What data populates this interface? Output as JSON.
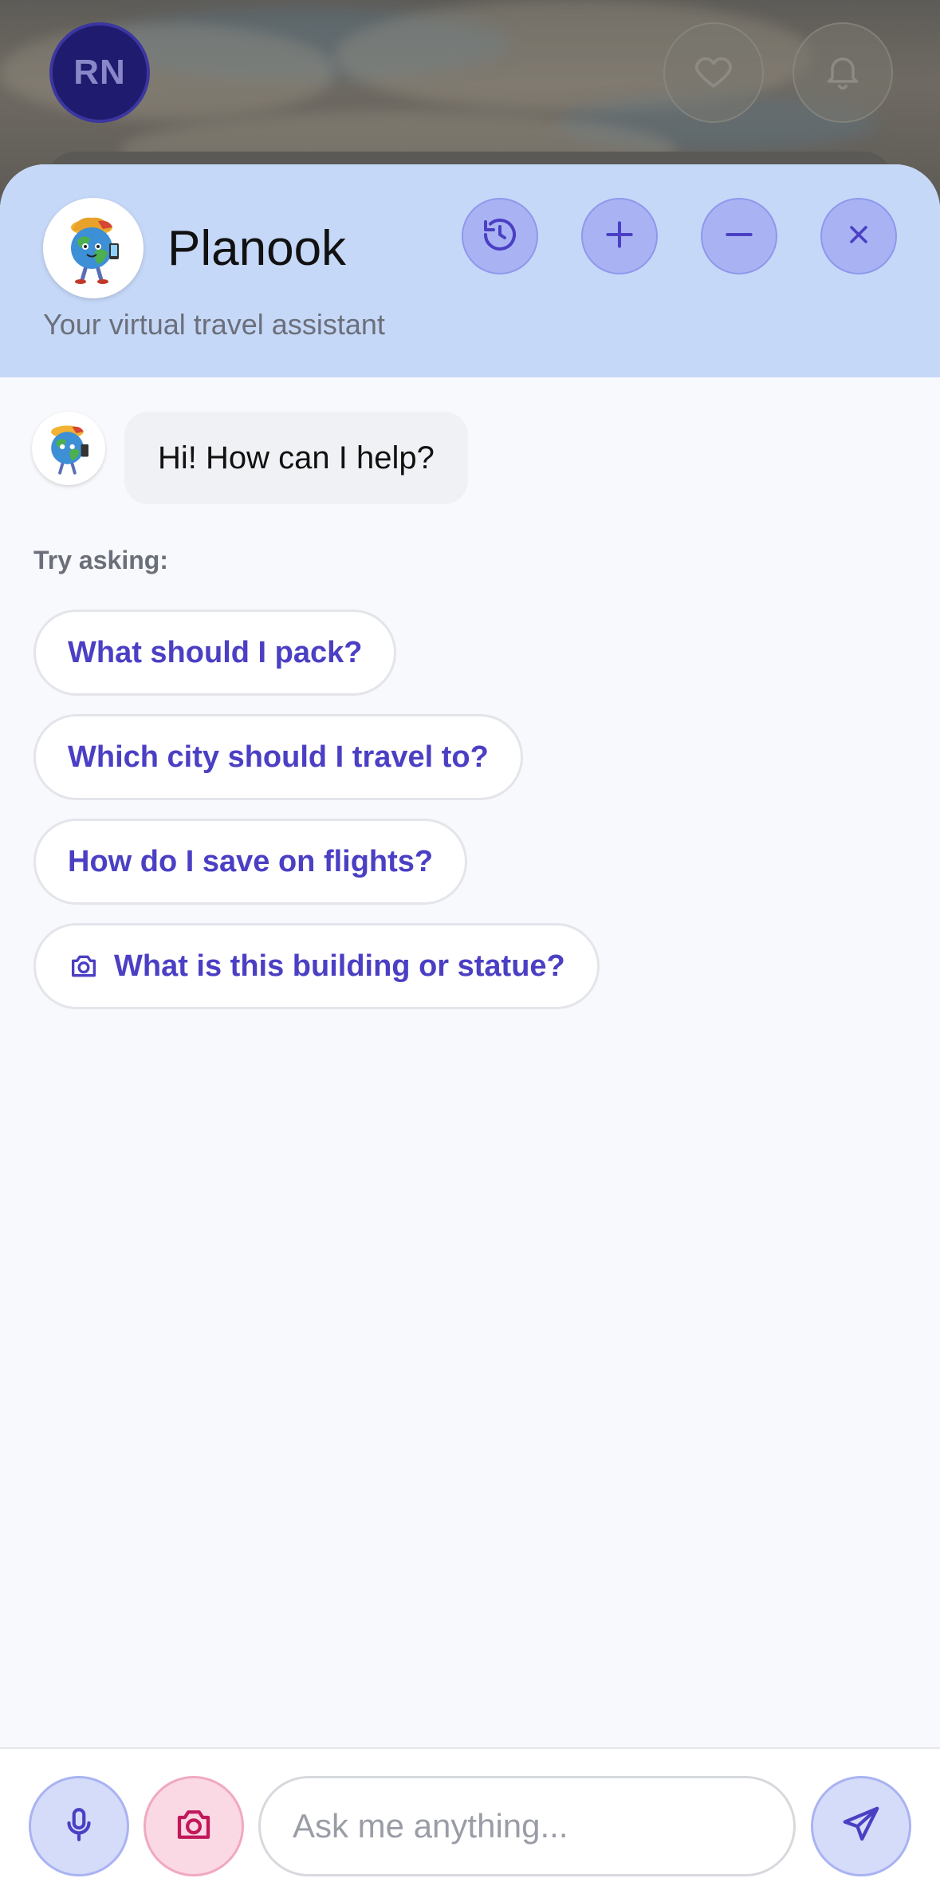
{
  "background_app": {
    "avatar_initials": "RN",
    "favorites_icon": "heart-icon",
    "notifications_icon": "bell-icon"
  },
  "assistant": {
    "name": "Planook",
    "subtitle": "Your virtual travel assistant",
    "header_buttons": [
      "history-icon",
      "plus-icon",
      "minus-icon",
      "close-icon"
    ]
  },
  "chat": {
    "greeting": "Hi! How can I help?",
    "try_label": "Try asking:",
    "suggestions": [
      {
        "label": "What should I pack?",
        "icon": ""
      },
      {
        "label": "Which city should I travel to?",
        "icon": ""
      },
      {
        "label": "How do I save on flights?",
        "icon": ""
      },
      {
        "label": "What is this building or statue?",
        "icon": "camera-icon"
      }
    ]
  },
  "composer": {
    "placeholder": "Ask me anything...",
    "mic_icon": "microphone-icon",
    "camera_icon": "camera-icon",
    "send_icon": "send-icon"
  },
  "colors": {
    "accent": "#4b3fc4",
    "header_bg": "#c6d8f8",
    "camera_accent": "#c2185b"
  }
}
